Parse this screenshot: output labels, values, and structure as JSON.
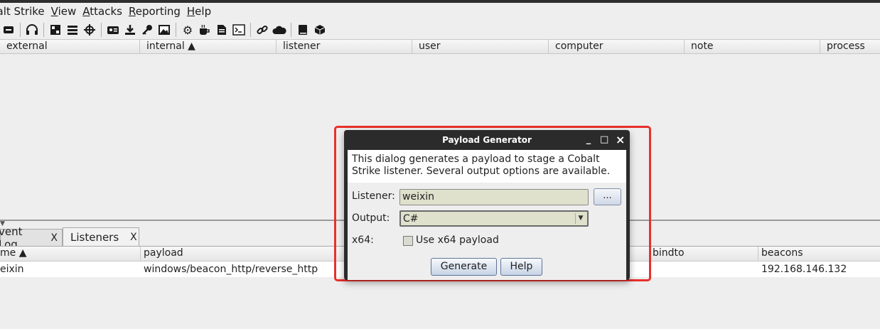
{
  "menubar": [
    "balt Strike",
    "View",
    "Attacks",
    "Reporting",
    "Help"
  ],
  "toolbar_icons": [
    "minus-icon",
    "headphones-icon",
    "sep",
    "pivot-graph-icon",
    "session-table-icon",
    "target-icon",
    "sep",
    "credentials-icon",
    "download-icon",
    "key-icon",
    "screenshot-icon",
    "sep",
    "settings-icon",
    "coffee-icon",
    "document-icon",
    "console-icon",
    "sep",
    "link-icon",
    "cloud-icon",
    "sep",
    "book-icon",
    "package-icon"
  ],
  "top_table": {
    "columns": [
      "external",
      "internal ▲",
      "listener",
      "user",
      "computer",
      "note",
      "process"
    ]
  },
  "tabs": [
    {
      "label": "vent Log",
      "close": "X"
    },
    {
      "label": "Listeners",
      "close": "X"
    }
  ],
  "listeners_table": {
    "columns": [
      "me ▲",
      "payload",
      "bindto",
      "beacons"
    ],
    "rows": [
      [
        "eixin",
        "windows/beacon_http/reverse_http",
        "",
        "192.168.146.132"
      ]
    ]
  },
  "dialog": {
    "title": "Payload Generator",
    "minimize": "_",
    "maximize": "□",
    "close": "×",
    "description": "This dialog generates a payload to stage a Cobalt Strike listener. Several output options are available.",
    "listener_label": "Listener:",
    "listener_value": "weixin",
    "browse_label": "...",
    "output_label": "Output:",
    "output_value": "C#",
    "x64_label": "x64:",
    "x64_checkbox_label": "Use x64 payload",
    "x64_checked": false,
    "generate_label": "Generate",
    "help_label": "Help"
  },
  "colors": {
    "highlight_box": "#e8302a",
    "dialog_titlebar": "#2b2b2b"
  }
}
